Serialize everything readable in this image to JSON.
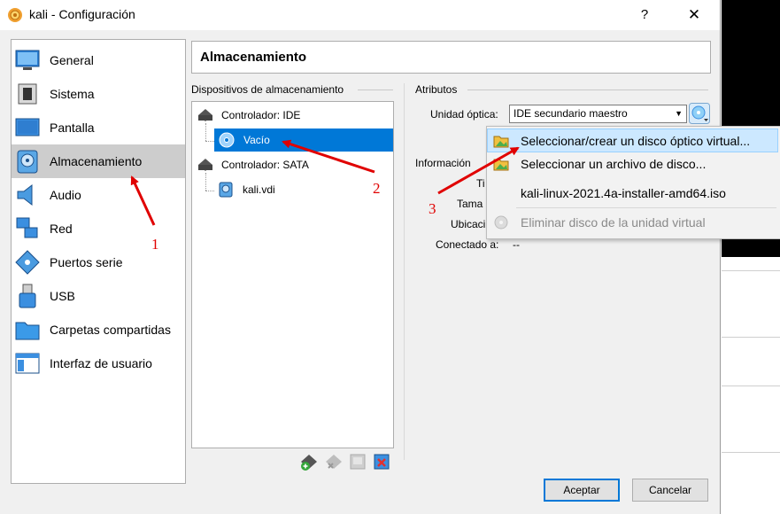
{
  "window": {
    "title": "kali - Configuración",
    "help": "?",
    "close": "✕"
  },
  "sidebar": {
    "items": [
      {
        "label": "General",
        "icon": "monitor-icon"
      },
      {
        "label": "Sistema",
        "icon": "chip-icon"
      },
      {
        "label": "Pantalla",
        "icon": "display-icon"
      },
      {
        "label": "Almacenamiento",
        "icon": "disk-icon",
        "selected": true
      },
      {
        "label": "Audio",
        "icon": "speaker-icon"
      },
      {
        "label": "Red",
        "icon": "network-icon"
      },
      {
        "label": "Puertos serie",
        "icon": "serial-port-icon"
      },
      {
        "label": "USB",
        "icon": "usb-icon"
      },
      {
        "label": "Carpetas compartidas",
        "icon": "folder-icon"
      },
      {
        "label": "Interfaz de usuario",
        "icon": "ui-window-icon"
      }
    ]
  },
  "main": {
    "title": "Almacenamiento",
    "devices_group": "Dispositivos de almacenamiento",
    "tree": {
      "ide_controller": "Controlador: IDE",
      "ide_child": "Vacío",
      "sata_controller": "Controlador: SATA",
      "sata_child": "kali.vdi"
    },
    "attributes_group": "Atributos",
    "optical_drive_label": "Unidad óptica:",
    "optical_drive_value": "IDE secundario maestro",
    "info_group": "Información",
    "info": {
      "type_label": "Ti",
      "size_label": "Tama",
      "location_label": "Ubicaci",
      "connected_label": "Conectado a:",
      "connected_value": "--"
    }
  },
  "menu": {
    "items": [
      {
        "label": "Seleccionar/crear un disco óptico virtual...",
        "icon": "folder-image-icon",
        "highlight": true
      },
      {
        "label": "Seleccionar un archivo de disco...",
        "icon": "folder-image-icon"
      },
      {
        "label": "kali-linux-2021.4a-installer-amd64.iso",
        "icon": ""
      },
      {
        "label": "Eliminar disco de la unidad virtual",
        "icon": "remove-disc-icon",
        "disabled": true
      }
    ]
  },
  "buttons": {
    "ok": "Aceptar",
    "cancel": "Cancelar"
  },
  "annotations": {
    "one": "1",
    "two": "2",
    "three": "3"
  },
  "colors": {
    "selection": "#0078d7",
    "annotation": "#e00000",
    "menu_highlight": "#cce8ff"
  }
}
